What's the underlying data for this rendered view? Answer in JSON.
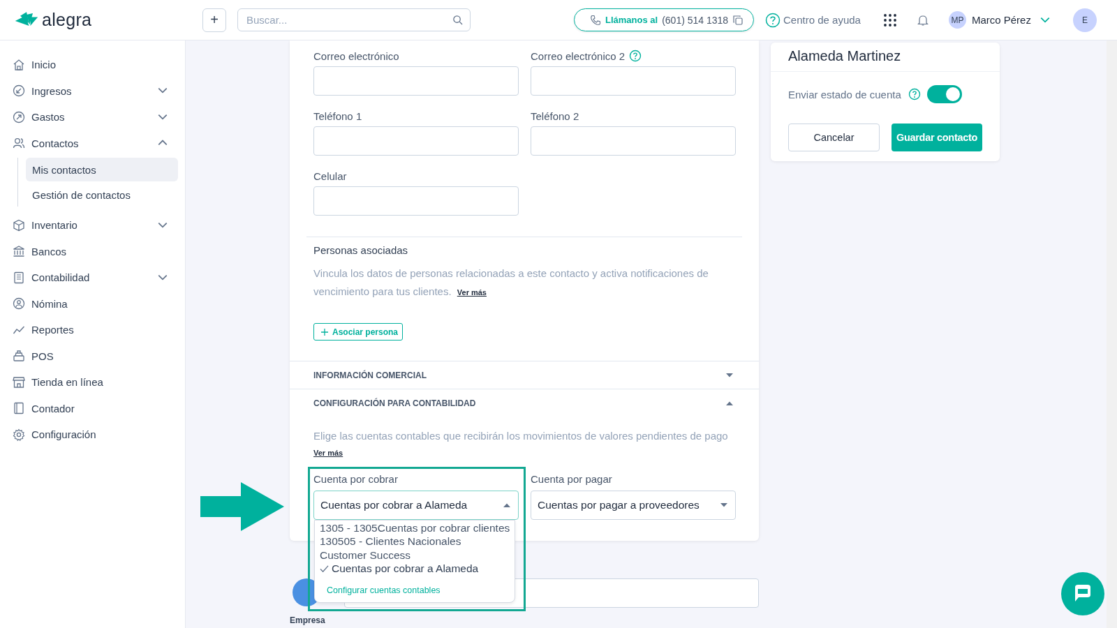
{
  "header": {
    "logo": "alegra",
    "new_button": "+",
    "search": {
      "placeholder": "Buscar..."
    },
    "phone": {
      "label": "Llámanos al",
      "number": "(601) 514 1318"
    },
    "help": "Centro de ayuda",
    "user": {
      "initials": "MP",
      "name": "Marco Pérez"
    },
    "company_avatar": "E"
  },
  "sidebar": {
    "items": [
      {
        "label": "Inicio"
      },
      {
        "label": "Ingresos",
        "expanded": false
      },
      {
        "label": "Gastos",
        "expanded": false
      },
      {
        "label": "Contactos",
        "expanded": true,
        "children": [
          {
            "label": "Mis contactos",
            "selected": true
          },
          {
            "label": "Gestión de contactos",
            "selected": false
          }
        ]
      },
      {
        "label": "Inventario",
        "expanded": false
      },
      {
        "label": "Bancos"
      },
      {
        "label": "Contabilidad",
        "expanded": false
      },
      {
        "label": "Nómina"
      },
      {
        "label": "Reportes"
      },
      {
        "label": "POS"
      },
      {
        "label": "Tienda en línea"
      },
      {
        "label": "Contador"
      },
      {
        "label": "Configuración"
      }
    ]
  },
  "form": {
    "fields": [
      {
        "label": "Correo electrónico",
        "help": false
      },
      {
        "label": "Correo electrónico 2",
        "help": true
      },
      {
        "label": "Teléfono 1",
        "help": false
      },
      {
        "label": "Teléfono 2",
        "help": false
      },
      {
        "label": "Celular",
        "help": false
      }
    ],
    "associated_persons": {
      "title": "Personas asociadas",
      "description": "Vincula los datos de personas relacionadas a este contacto y activa notificaciones de vencimiento para tus clientes.",
      "link": "Ver más",
      "button": "Asociar persona"
    },
    "sections": [
      {
        "title": "INFORMACIÓN COMERCIAL",
        "expanded": false
      },
      {
        "title": "CONFIGURACIÓN PARA CONTABILIDAD",
        "expanded": true
      }
    ],
    "accounting": {
      "description": "Elige las cuentas contables que recibirán los movimientos de valores pendientes de pago",
      "link": "Ver más",
      "selects": [
        {
          "label": "Cuenta por cobrar",
          "value": "Cuentas por cobrar a Alameda",
          "open": true
        },
        {
          "label": "Cuenta por pagar",
          "value": "Cuentas por pagar a proveedores",
          "open": false
        }
      ],
      "dropdown": {
        "options": [
          {
            "label": "1305 - 1305Cuentas por cobrar clientes",
            "selected": false
          },
          {
            "label": "130505 - Clientes Nacionales",
            "selected": false
          },
          {
            "label": "Customer Success",
            "selected": false
          },
          {
            "label": "Cuentas por cobrar a Alameda",
            "selected": true
          }
        ],
        "footer_link": "Configurar cuentas contables"
      }
    }
  },
  "below": {
    "caption": "Empresa"
  },
  "summary": {
    "title": "Alameda Martinez",
    "toggle": {
      "label": "Enviar estado de cuenta",
      "on": true
    },
    "buttons": [
      {
        "label": "Cancelar",
        "kind": "secondary"
      },
      {
        "label": "Guardar contacto",
        "kind": "primary"
      }
    ]
  }
}
